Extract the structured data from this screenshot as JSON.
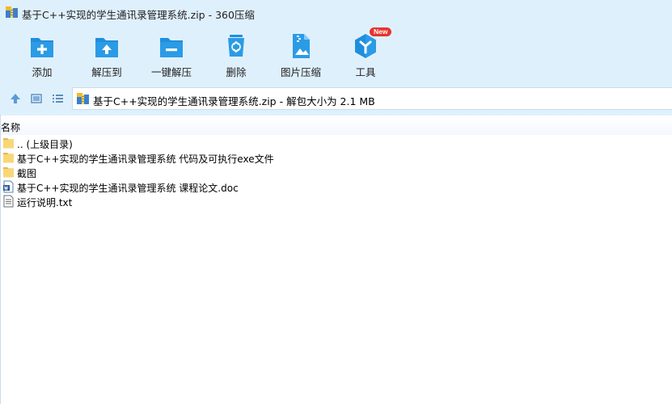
{
  "window": {
    "title": "基于C++实现的学生通讯录管理系统.zip - 360压缩"
  },
  "toolbar": {
    "items": [
      {
        "label": "添加",
        "icon": "add-folder-icon"
      },
      {
        "label": "解压到",
        "icon": "extract-to-folder-icon"
      },
      {
        "label": "一键解压",
        "icon": "one-click-extract-icon"
      },
      {
        "label": "删除",
        "icon": "recycle-bin-icon"
      },
      {
        "label": "图片压缩",
        "icon": "image-compress-icon"
      },
      {
        "label": "工具",
        "icon": "tools-hexagon-icon",
        "badge": "New"
      }
    ]
  },
  "address": {
    "path": "基于C++实现的学生通讯录管理系统.zip - 解包大小为 2.1 MB"
  },
  "list": {
    "column_name": "名称",
    "rows": [
      {
        "name": ".. (上级目录)",
        "icon": "folder-icon"
      },
      {
        "name": "基于C++实现的学生通讯录管理系统 代码及可执行exe文件",
        "icon": "folder-icon"
      },
      {
        "name": "截图",
        "icon": "folder-icon"
      },
      {
        "name": "基于C++实现的学生通讯录管理系统 课程论文.doc",
        "icon": "word-doc-icon"
      },
      {
        "name": "运行说明.txt",
        "icon": "text-file-icon"
      }
    ]
  },
  "colors": {
    "chrome_bg": "#dff0fd",
    "tool_blue": "#1e8fdc",
    "folder_yellow": "#f8d775",
    "badge_red": "#e8332d"
  }
}
